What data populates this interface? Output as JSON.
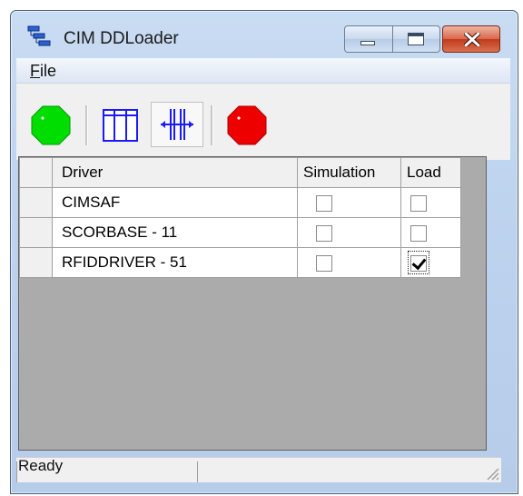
{
  "window": {
    "title": "CIM DDLoader",
    "icon": "app-network-icon",
    "caption_buttons": [
      "minimize",
      "maximize",
      "close"
    ]
  },
  "menu": {
    "items": [
      {
        "label": "File",
        "accel": "F"
      }
    ]
  },
  "toolbar": {
    "buttons": [
      {
        "name": "start",
        "icon": "green-octagon-icon"
      },
      {
        "name": "columns",
        "icon": "columns-grid-icon"
      },
      {
        "name": "resize-columns",
        "icon": "column-resize-icon",
        "pressed": true
      },
      {
        "name": "stop",
        "icon": "red-octagon-icon"
      }
    ]
  },
  "grid": {
    "columns": [
      "Driver",
      "Simulation",
      "Load"
    ],
    "rows": [
      {
        "driver": "CIMSAF",
        "simulation": false,
        "load": false
      },
      {
        "driver": "SCORBASE - 11",
        "simulation": false,
        "load": false
      },
      {
        "driver": "RFIDDRIVER -  51",
        "simulation": false,
        "load": true
      }
    ]
  },
  "status": {
    "text": "Ready"
  },
  "colors": {
    "start_green": "#00dd00",
    "stop_red": "#ee0000",
    "grid_background": "#ababab"
  }
}
